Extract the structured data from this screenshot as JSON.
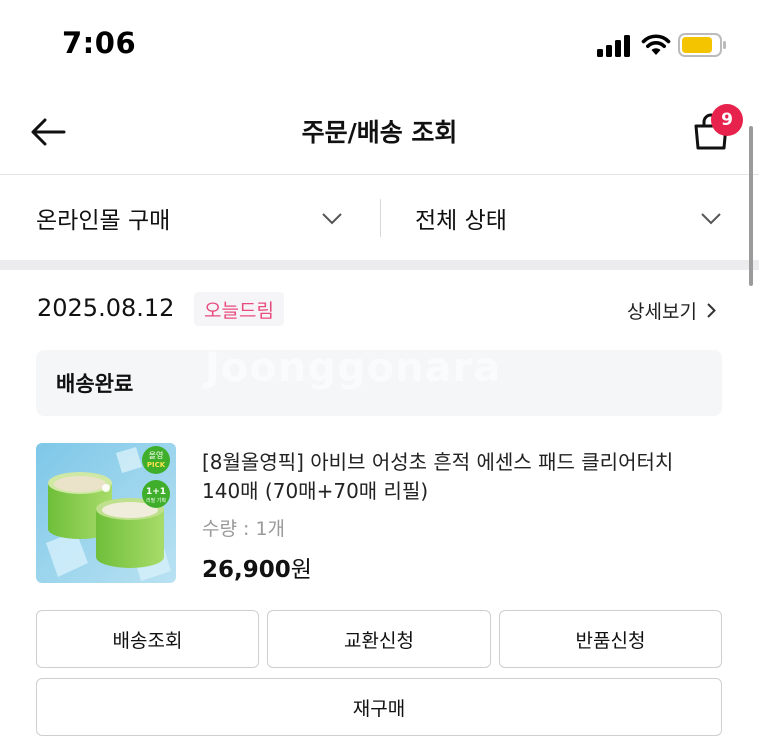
{
  "status_bar": {
    "time": "7:06"
  },
  "header": {
    "title": "주문/배송 조회",
    "cart_count": "9"
  },
  "filters": {
    "purchase_type": "온라인몰 구매",
    "status": "전체 상태"
  },
  "order": {
    "date": "2025.08.12",
    "tag": "오늘드림",
    "detail_label": "상세보기",
    "status": "배송완료",
    "watermark": "Joonggonara",
    "product": {
      "name": "[8월올영픽] 아비브 어성초 흔적 에센스 패드 클리어터치 140매 (70매+70매 리필)",
      "thumb_badge_line1": "올영",
      "thumb_badge_line2": "PICK",
      "thumb_promo_line1": "1+1",
      "thumb_promo_line2": "리필 기획",
      "quantity": "수량 : 1개",
      "price": "26,900",
      "currency": "원"
    },
    "buttons": {
      "track": "배송조회",
      "exchange": "교환신청",
      "return": "반품신청",
      "reorder": "재구매"
    }
  },
  "colors": {
    "badge": "#e6224d",
    "tag_text": "#e94b7d",
    "status_bg": "#f4f6f8"
  }
}
